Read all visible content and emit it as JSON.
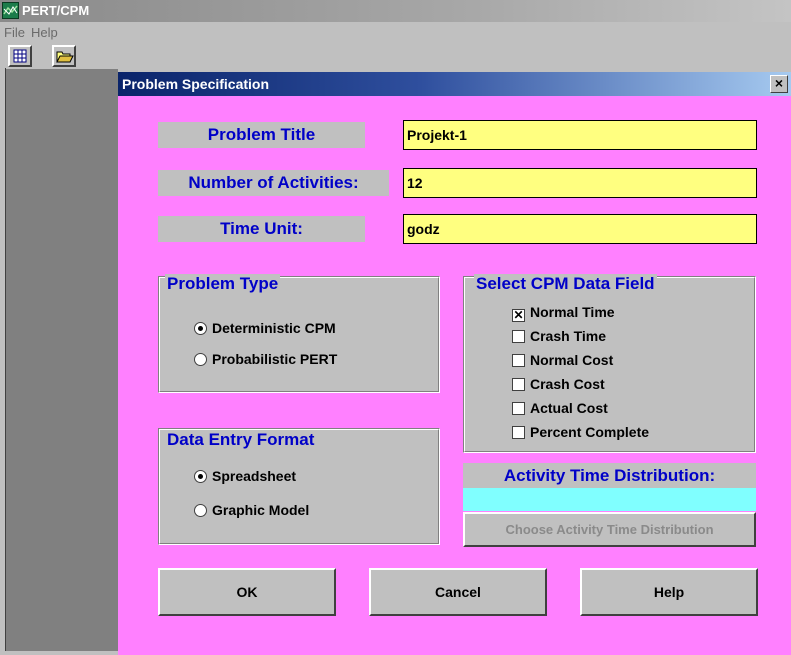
{
  "window": {
    "title": "PERT/CPM"
  },
  "menu": {
    "items": [
      "File",
      "Help"
    ]
  },
  "toolbar": {
    "buttons": [
      "spreadsheet-icon",
      "open-folder-icon"
    ]
  },
  "dialog": {
    "title": "Problem Specification",
    "close_label": "×",
    "problem_title": {
      "label": "Problem Title",
      "value": "Projekt-1"
    },
    "num_activities": {
      "label": "Number of Activities:",
      "value": "12"
    },
    "time_unit": {
      "label": "Time Unit:",
      "value": "godz"
    },
    "problem_type": {
      "legend": "Problem Type",
      "options": [
        "Deterministic CPM",
        "Probabilistic PERT"
      ],
      "selected": "Deterministic CPM"
    },
    "cpm_fields": {
      "legend": "Select CPM Data Field",
      "options": [
        {
          "label": "Normal Time",
          "checked": true
        },
        {
          "label": "Crash Time",
          "checked": false
        },
        {
          "label": "Normal Cost",
          "checked": false
        },
        {
          "label": "Crash Cost",
          "checked": false
        },
        {
          "label": "Actual Cost",
          "checked": false
        },
        {
          "label": "Percent Complete",
          "checked": false
        }
      ]
    },
    "data_entry": {
      "legend": "Data Entry Format",
      "options": [
        "Spreadsheet",
        "Graphic Model"
      ],
      "selected": "Spreadsheet"
    },
    "distribution": {
      "label": "Activity Time Distribution:",
      "value": "",
      "button": "Choose Activity Time Distribution"
    },
    "buttons": {
      "ok": "OK",
      "cancel": "Cancel",
      "help": "Help"
    }
  },
  "colors": {
    "dialog_bg": "#ff80ff",
    "field_bg": "#ffff80",
    "label_text": "#0000c8",
    "distribution_bg": "#80ffff"
  }
}
